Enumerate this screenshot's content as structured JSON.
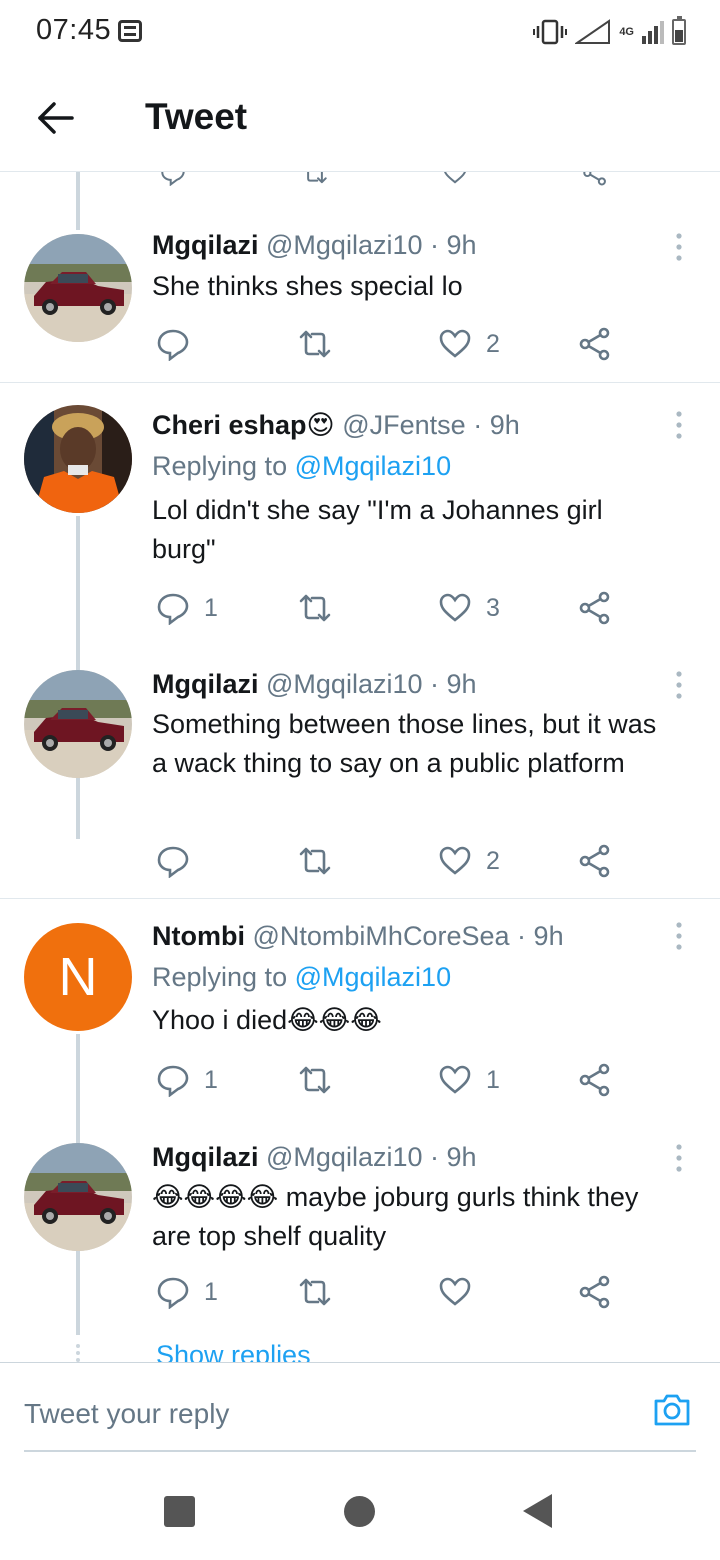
{
  "status_bar": {
    "time": "07:45",
    "network": "4G"
  },
  "header": {
    "title": "Tweet"
  },
  "tweets": [
    {
      "name": "Mgqilazi",
      "handle": "@Mgqilazi10",
      "time": "9h",
      "text": "She thinks shes special lo",
      "actions": {
        "reply": "",
        "retweet": "",
        "like": "2"
      }
    },
    {
      "name": "Cheri eshap😍",
      "handle": "@JFentse",
      "time": "9h",
      "replying_prefix": "Replying to",
      "replying_to": "@Mgqilazi10",
      "text": "Lol didn't she say \"I'm a Johannes girl burg\"",
      "actions": {
        "reply": "1",
        "retweet": "",
        "like": "3"
      }
    },
    {
      "name": "Mgqilazi",
      "handle": "@Mgqilazi10",
      "time": "9h",
      "text": "Something between those lines, but it was a wack thing to say on a public platform",
      "actions": {
        "reply": "",
        "retweet": "",
        "like": "2"
      }
    },
    {
      "name": "Ntombi",
      "handle": "@NtombiMhCoreSea",
      "time": "9h",
      "avatar_letter": "N",
      "replying_prefix": "Replying to",
      "replying_to": "@Mgqilazi10",
      "text": "Yhoo i died😂😂😂",
      "actions": {
        "reply": "1",
        "retweet": "",
        "like": "1"
      }
    },
    {
      "name": "Mgqilazi",
      "handle": "@Mgqilazi10",
      "time": "9h",
      "text": "😂😂😂😂 maybe joburg gurls think they are top shelf quality",
      "actions": {
        "reply": "1",
        "retweet": "",
        "like": ""
      }
    }
  ],
  "show_replies": "Show replies",
  "reply_box": {
    "placeholder": "Tweet your reply"
  },
  "colors": {
    "accent": "#1da1f2",
    "secondary_text": "#657786",
    "divider": "#e1e8ed",
    "avatar_orange": "#f0700d"
  }
}
